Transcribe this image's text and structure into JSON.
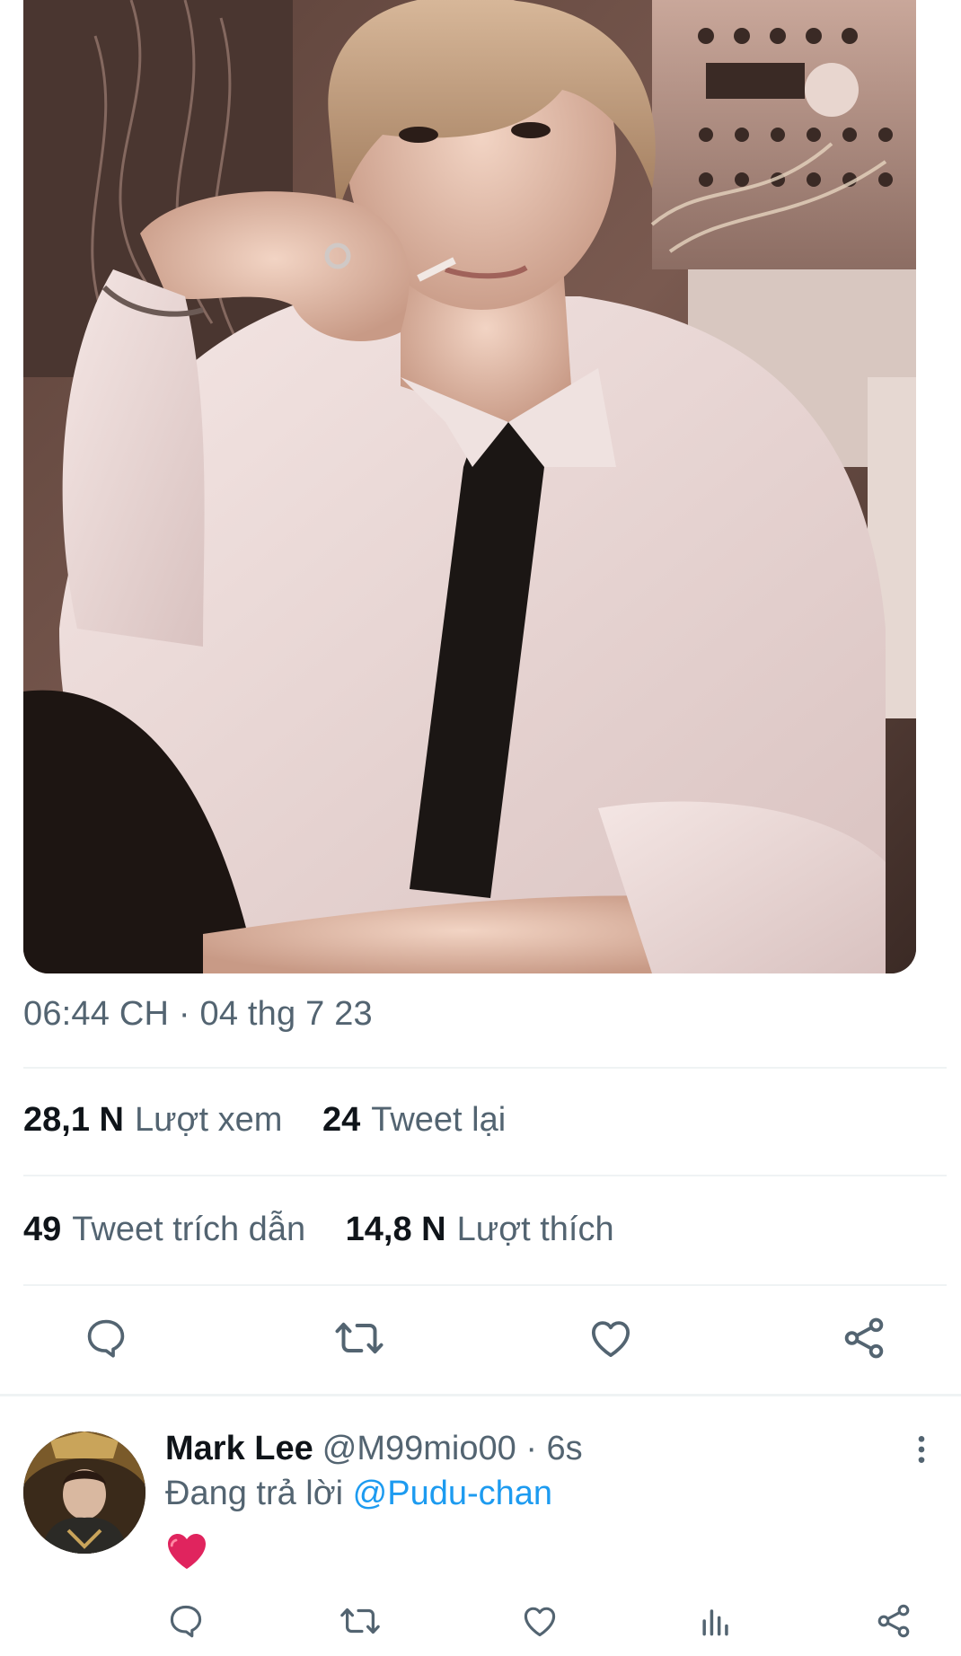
{
  "tweet": {
    "image_alt": "",
    "timestamp": "06:44 CH · 04 thg 7 23",
    "stats_row1": [
      {
        "num": "28,1 N",
        "label": "Lượt xem"
      },
      {
        "num": "24",
        "label": "Tweet lại"
      }
    ],
    "stats_row2": [
      {
        "num": "49",
        "label": "Tweet trích dẫn"
      },
      {
        "num": "14,8 N",
        "label": "Lượt thích"
      }
    ],
    "actions": {
      "reply_icon": "reply-icon",
      "retweet_icon": "retweet-icon",
      "like_icon": "heart-icon",
      "share_icon": "share-icon"
    }
  },
  "reply": {
    "name": "Mark Lee",
    "handle": "@M99mio00",
    "time": "· 6s",
    "replying_prefix": "Đang trả lời",
    "replying_to": "@Pudu-chan",
    "emoji": "❤️",
    "actions": [
      "reply-icon",
      "retweet-icon",
      "heart-icon",
      "analytics-icon",
      "share-icon"
    ]
  },
  "colors": {
    "text_primary": "#0f1419",
    "text_secondary": "#536471",
    "link": "#1d9bf0",
    "divider": "#eff3f4",
    "heart_emoji": "#e0245e"
  }
}
